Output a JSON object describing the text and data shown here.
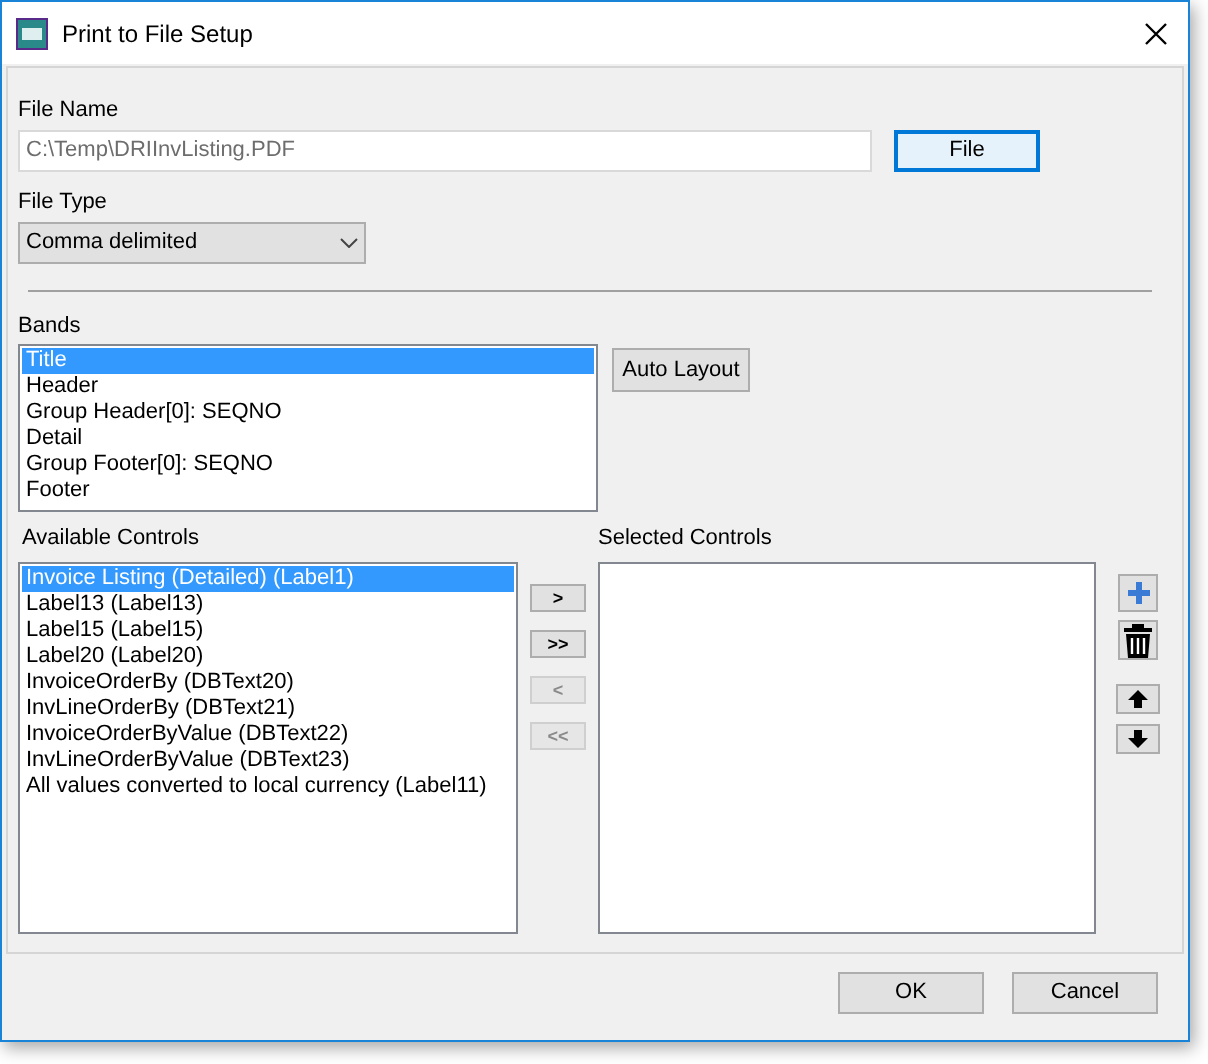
{
  "window": {
    "title": "Print to File Setup"
  },
  "file_name": {
    "label": "File Name",
    "value": "C:\\Temp\\DRIInvListing.PDF",
    "button": "File"
  },
  "file_type": {
    "label": "File Type",
    "value": "Comma delimited"
  },
  "bands": {
    "label": "Bands",
    "button": "Auto Layout",
    "items": [
      {
        "label": "Title",
        "selected": true
      },
      {
        "label": "Header",
        "selected": false
      },
      {
        "label": "Group Header[0]: SEQNO",
        "selected": false
      },
      {
        "label": "Detail",
        "selected": false
      },
      {
        "label": "Group Footer[0]: SEQNO",
        "selected": false
      },
      {
        "label": "Footer",
        "selected": false
      }
    ]
  },
  "available_controls": {
    "label": "Available Controls",
    "items": [
      {
        "label": "Invoice Listing (Detailed) (Label1)",
        "selected": true
      },
      {
        "label": "Label13 (Label13)",
        "selected": false
      },
      {
        "label": "Label15 (Label15)",
        "selected": false
      },
      {
        "label": "Label20 (Label20)",
        "selected": false
      },
      {
        "label": "InvoiceOrderBy (DBText20)",
        "selected": false
      },
      {
        "label": "InvLineOrderBy (DBText21)",
        "selected": false
      },
      {
        "label": "InvoiceOrderByValue (DBText22)",
        "selected": false
      },
      {
        "label": "InvLineOrderByValue (DBText23)",
        "selected": false
      },
      {
        "label": "All values converted to local currency (Label11)",
        "selected": false
      }
    ]
  },
  "transfer_buttons": [
    {
      "label": ">",
      "disabled": false
    },
    {
      "label": ">>",
      "disabled": false
    },
    {
      "label": "<",
      "disabled": true
    },
    {
      "label": "<<",
      "disabled": true
    }
  ],
  "selected_controls": {
    "label": "Selected Controls"
  },
  "buttons": [
    "OK",
    "Cancel"
  ]
}
